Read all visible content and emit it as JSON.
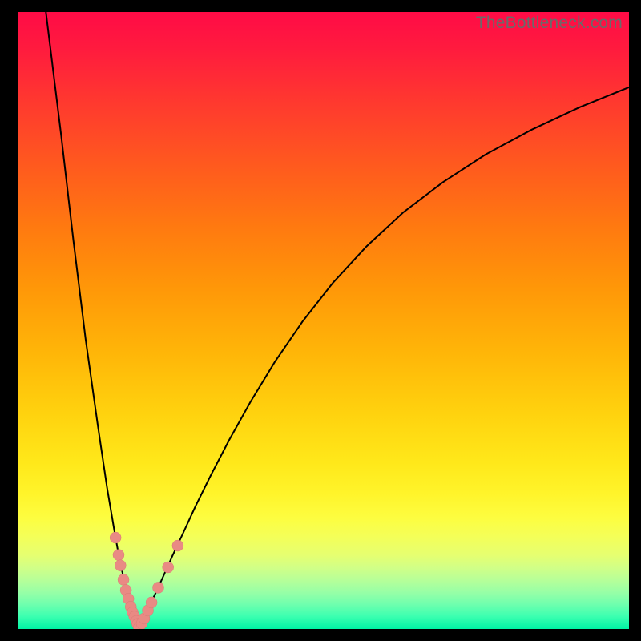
{
  "watermark": "TheBottleneck.com",
  "colors": {
    "curve_stroke": "#000000",
    "marker_fill": "#e98a84",
    "marker_stroke": "#d97a74"
  },
  "chart_data": {
    "type": "line",
    "title": "",
    "xlabel": "",
    "ylabel": "",
    "xlim": [
      0,
      100
    ],
    "ylim": [
      0,
      100
    ],
    "series": [
      {
        "name": "curve-left",
        "x": [
          4.5,
          7,
          9,
          11,
          13,
          14.5,
          15.7,
          16.6,
          17.3,
          17.9,
          18.4,
          18.8,
          19.1,
          19.35,
          19.55,
          19.74
        ],
        "y": [
          100,
          80,
          63,
          47,
          33,
          23,
          16,
          11,
          8,
          5.5,
          3.8,
          2.6,
          1.8,
          1.2,
          0.7,
          0.0
        ]
      },
      {
        "name": "curve-right",
        "x": [
          19.74,
          20.2,
          20.8,
          21.6,
          22.6,
          23.8,
          25.2,
          27,
          29,
          31.5,
          34.5,
          38,
          42,
          46.5,
          51.5,
          57,
          63,
          69.5,
          76.5,
          84,
          92,
          100
        ],
        "y": [
          0.0,
          1.0,
          2.3,
          4.0,
          6.1,
          8.7,
          11.8,
          15.6,
          19.9,
          24.9,
          30.6,
          36.8,
          43.3,
          49.8,
          56.1,
          62.0,
          67.5,
          72.4,
          76.9,
          80.9,
          84.6,
          87.8
        ]
      }
    ],
    "markers": [
      {
        "x": 15.9,
        "y": 14.8
      },
      {
        "x": 16.4,
        "y": 12.0
      },
      {
        "x": 16.7,
        "y": 10.3
      },
      {
        "x": 17.2,
        "y": 8.0
      },
      {
        "x": 17.6,
        "y": 6.3
      },
      {
        "x": 18.0,
        "y": 4.9
      },
      {
        "x": 18.4,
        "y": 3.6
      },
      {
        "x": 18.7,
        "y": 2.7
      },
      {
        "x": 19.0,
        "y": 2.0
      },
      {
        "x": 19.3,
        "y": 1.3
      },
      {
        "x": 19.5,
        "y": 0.8
      },
      {
        "x": 19.74,
        "y": 0.25
      },
      {
        "x": 20.2,
        "y": 0.9
      },
      {
        "x": 20.6,
        "y": 1.7
      },
      {
        "x": 21.2,
        "y": 3.0
      },
      {
        "x": 21.8,
        "y": 4.3
      },
      {
        "x": 22.9,
        "y": 6.7
      },
      {
        "x": 24.5,
        "y": 10.0
      },
      {
        "x": 26.1,
        "y": 13.5
      }
    ]
  }
}
